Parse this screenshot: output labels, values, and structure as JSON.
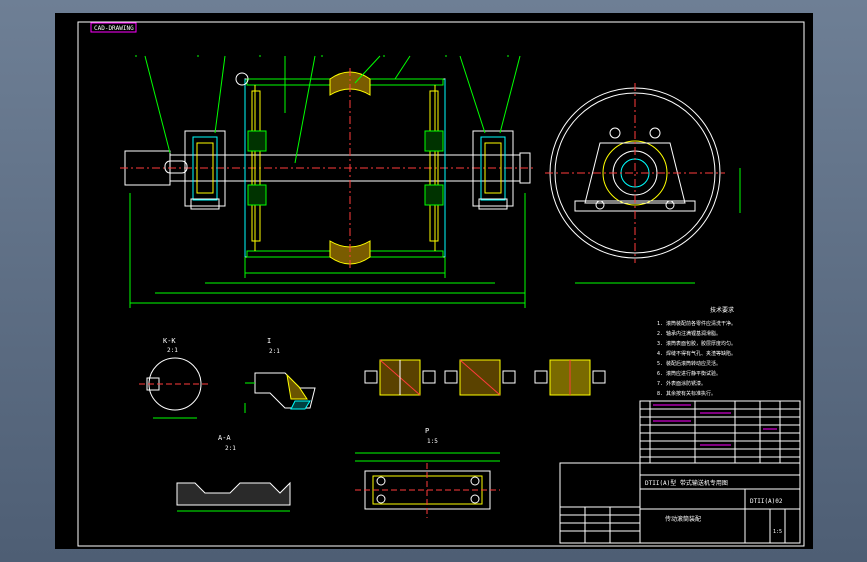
{
  "drawing": {
    "title_tag": "CAD-DRAWING",
    "section_labels": {
      "kk": "K-K",
      "kk_scale": "2:1",
      "ii": "I",
      "ii_scale": "2:1",
      "aa": "A-A",
      "aa_scale": "2:1",
      "pp": "P",
      "pp_scale": "1:5"
    },
    "tech_req_title": "技术要求",
    "tech_req_lines": [
      "1. 滚筒装配前各零件应清洗干净。",
      "2. 轴承内注满锂基润滑脂。",
      "3. 滚筒表面包胶，胶层厚度均匀。",
      "4. 焊缝不得有气孔、夹渣等缺陷。",
      "5. 装配后滚筒转动应灵活。",
      "6. 滚筒应进行静平衡试验。",
      "7. 外表面涂防锈漆。",
      "8. 其余按有关标准执行。"
    ],
    "title_block": {
      "project": "DTII(A)型  带式输送机专用图",
      "drawing_name": "传动滚筒装配",
      "drawing_no": "DTII(A)02",
      "scale": "1:5"
    }
  }
}
